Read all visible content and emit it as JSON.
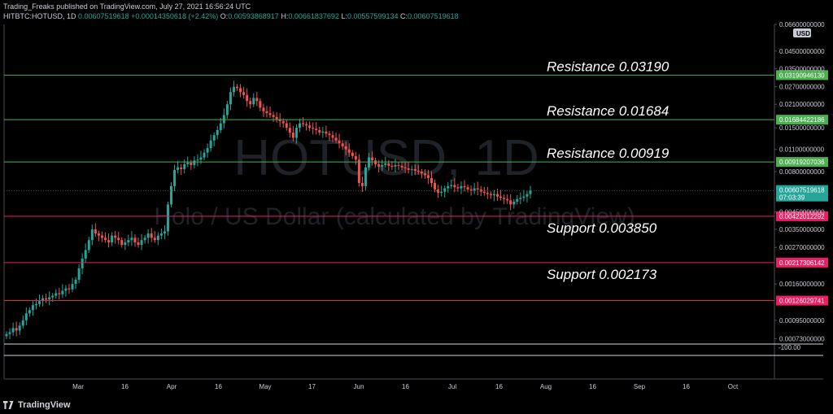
{
  "header": {
    "publish_line": "Trading_Freaks published on TradingView.com, July 27, 2021 16:56:24 UTC",
    "symbol": "HITBTC:HOTUSD, 1D",
    "last": "0.00607519618",
    "change": "+0.00014350618 (+2.42%)",
    "open_label": "O:",
    "open": "0.00593868917",
    "high_label": "H:",
    "high": "0.00661837692",
    "low_label": "L:",
    "low": "0.00557599134",
    "close_label": "C:",
    "close": "0.00607519618"
  },
  "watermark": {
    "symbol": "HOTUSD, 1D",
    "description": "Holo / US Dollar (calculated by TradingView)"
  },
  "currency_badge": "USD",
  "footer": {
    "brand": "TradingView"
  },
  "colors": {
    "up": "#26a69a",
    "down": "#ef5350",
    "resistance": "#4caf50",
    "support": "#e91e63",
    "grid_dot": "#2a5a3a"
  },
  "chart_data": {
    "type": "candlestick",
    "scale": "log",
    "price_axis_ticks": [
      "0.06600000000",
      "0.04500000000",
      "0.03500000000",
      "0.02700000000",
      "0.02100000000",
      "0.01500000000",
      "0.01100000000",
      "0.00800000000",
      "0.00450000000",
      "0.00350000000",
      "0.00270000000",
      "0.00160000000",
      "0.00095000000",
      "0.00073000000"
    ],
    "price_axis_tick_values": [
      0.066,
      0.045,
      0.035,
      0.027,
      0.021,
      0.015,
      0.011,
      0.008,
      0.0045,
      0.0035,
      0.0027,
      0.0016,
      0.00095,
      0.00073
    ],
    "ylim": [
      0.0007,
      0.066
    ],
    "volume_axis_label": "-100.00",
    "x_ticks": [
      "Mar",
      "16",
      "Apr",
      "16",
      "May",
      "17",
      "Jun",
      "16",
      "Jul",
      "16",
      "Aug",
      "16",
      "Sep",
      "16",
      "Oct"
    ],
    "current_price": {
      "value": 0.00607519618,
      "label": "0.00607519618",
      "countdown": "07:03:39"
    },
    "levels": [
      {
        "kind": "resistance",
        "value": 0.0319094613,
        "label": "Resistance 0.03190",
        "price_label": "0.03190946130"
      },
      {
        "kind": "resistance",
        "value": 0.01684422186,
        "label": "Resistance 0.01684",
        "price_label": "0.01684422186"
      },
      {
        "kind": "resistance",
        "value": 0.00919207036,
        "label": "Resistance 0.00919",
        "price_label": "0.00919207036"
      },
      {
        "kind": "support",
        "value": 0.0042201229,
        "label": "Support 0.003850",
        "price_label": "0.00422012292"
      },
      {
        "kind": "support",
        "value": 0.00217306142,
        "label": "Support 0.002173",
        "price_label": "0.00217306142"
      },
      {
        "kind": "support",
        "value": 0.00126029741,
        "label": "",
        "price_label": "0.00126029741"
      }
    ],
    "close_series_approx": [
      0.00078,
      0.0008,
      0.00085,
      0.00082,
      0.00088,
      0.00095,
      0.00105,
      0.0011,
      0.00118,
      0.0012,
      0.00125,
      0.0013,
      0.00128,
      0.00132,
      0.00135,
      0.0014,
      0.00138,
      0.00145,
      0.0015,
      0.00148,
      0.0016,
      0.0017,
      0.002,
      0.0023,
      0.0026,
      0.003,
      0.0035,
      0.0033,
      0.0032,
      0.0031,
      0.003,
      0.0029,
      0.0032,
      0.0031,
      0.003,
      0.0028,
      0.0029,
      0.003,
      0.0031,
      0.0029,
      0.0028,
      0.003,
      0.0031,
      0.0033,
      0.0031,
      0.003,
      0.0032,
      0.0033,
      0.0034,
      0.005,
      0.0065,
      0.0082,
      0.0085,
      0.0083,
      0.0089,
      0.0091,
      0.0088,
      0.0094,
      0.0095,
      0.0098,
      0.0105,
      0.0112,
      0.0125,
      0.0135,
      0.0145,
      0.016,
      0.018,
      0.021,
      0.025,
      0.027,
      0.0265,
      0.025,
      0.024,
      0.022,
      0.021,
      0.023,
      0.022,
      0.02,
      0.019,
      0.0185,
      0.018,
      0.0175,
      0.017,
      0.0165,
      0.016,
      0.015,
      0.014,
      0.013,
      0.015,
      0.016,
      0.0158,
      0.0155,
      0.015,
      0.0148,
      0.0145,
      0.014,
      0.0142,
      0.0138,
      0.0135,
      0.013,
      0.0125,
      0.012,
      0.0115,
      0.011,
      0.0105,
      0.01,
      0.0095,
      0.0068,
      0.0065,
      0.0085,
      0.0098,
      0.0094,
      0.0089,
      0.0086,
      0.0088,
      0.009,
      0.0087,
      0.0086,
      0.0088,
      0.0087,
      0.0085,
      0.0084,
      0.0082,
      0.0083,
      0.0081,
      0.008,
      0.0078,
      0.0076,
      0.0073,
      0.0068,
      0.0062,
      0.0059,
      0.006,
      0.0063,
      0.0065,
      0.0066,
      0.0064,
      0.0063,
      0.0065,
      0.0064,
      0.0062,
      0.0061,
      0.0063,
      0.0062,
      0.006,
      0.0059,
      0.0058,
      0.0057,
      0.0058,
      0.0056,
      0.0055,
      0.0054,
      0.0053,
      0.005,
      0.0052,
      0.0054,
      0.0055,
      0.0056,
      0.0058,
      0.0061
    ]
  }
}
